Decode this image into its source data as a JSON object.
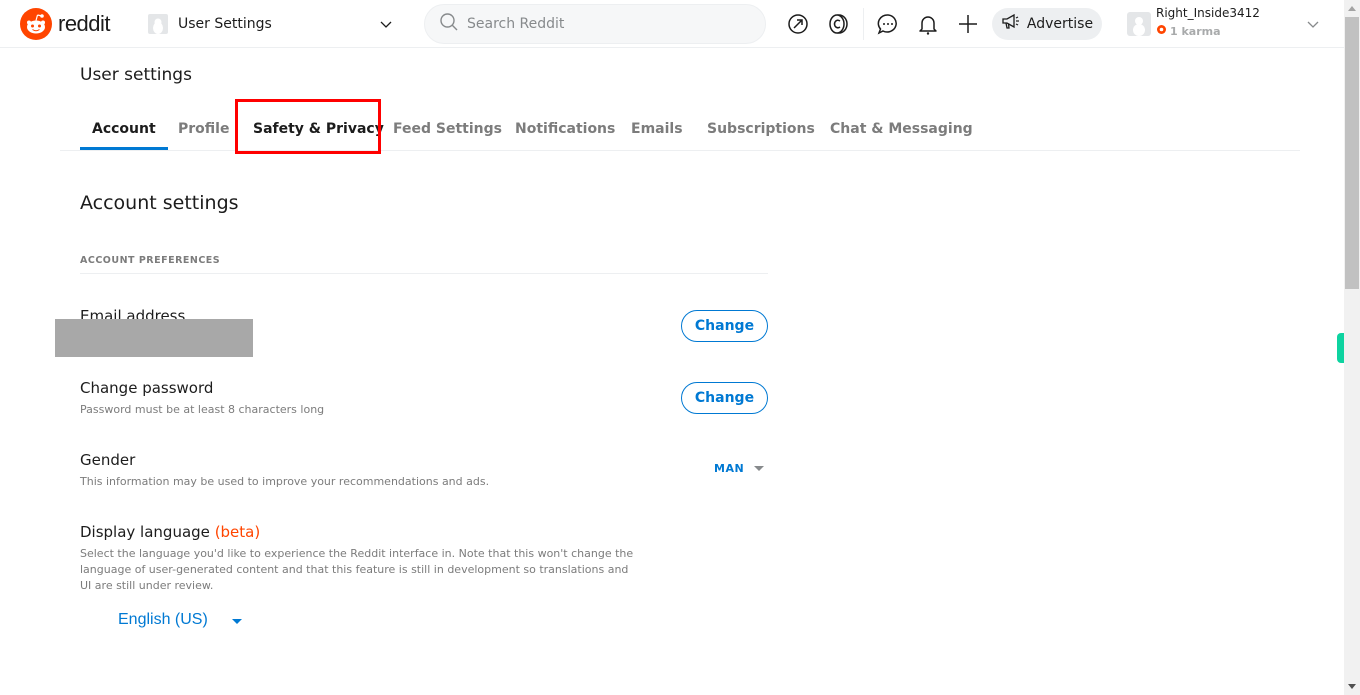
{
  "header": {
    "logo_text": "reddit",
    "community_label": "User Settings",
    "search_placeholder": "Search Reddit",
    "icons": [
      "popular-icon",
      "coins-icon",
      "chat-icon",
      "notifications-icon",
      "create-post-icon"
    ],
    "advertise_label": "Advertise",
    "user": {
      "name": "Right_Inside3412",
      "karma": "1 karma"
    }
  },
  "page": {
    "title": "User settings",
    "tabs": [
      {
        "label": "Account",
        "active": true
      },
      {
        "label": "Profile",
        "active": false
      },
      {
        "label": "Safety & Privacy",
        "active": false,
        "highlighted": true
      },
      {
        "label": "Feed Settings",
        "active": false
      },
      {
        "label": "Notifications",
        "active": false
      },
      {
        "label": "Emails",
        "active": false
      },
      {
        "label": "Subscriptions",
        "active": false
      },
      {
        "label": "Chat & Messaging",
        "active": false
      }
    ],
    "section_title": "Account settings",
    "preferences_header": "ACCOUNT PREFERENCES",
    "email": {
      "title": "Email address",
      "button": "Change"
    },
    "password": {
      "title": "Change password",
      "description": "Password must be at least 8 characters long",
      "button": "Change"
    },
    "gender": {
      "title": "Gender",
      "description": "This information may be used to improve your recommendations and ads.",
      "value": "MAN"
    },
    "language": {
      "title": "Display language",
      "beta": "(beta)",
      "description": "Select the language you'd like to experience the Reddit interface in. Note that this won't change the language of user-generated content and that this feature is still in development so translations and UI are still under review.",
      "value": "English (US)"
    }
  },
  "colors": {
    "brand": "#ff4500",
    "accent": "#0079d3",
    "highlight": "#ff0000"
  }
}
